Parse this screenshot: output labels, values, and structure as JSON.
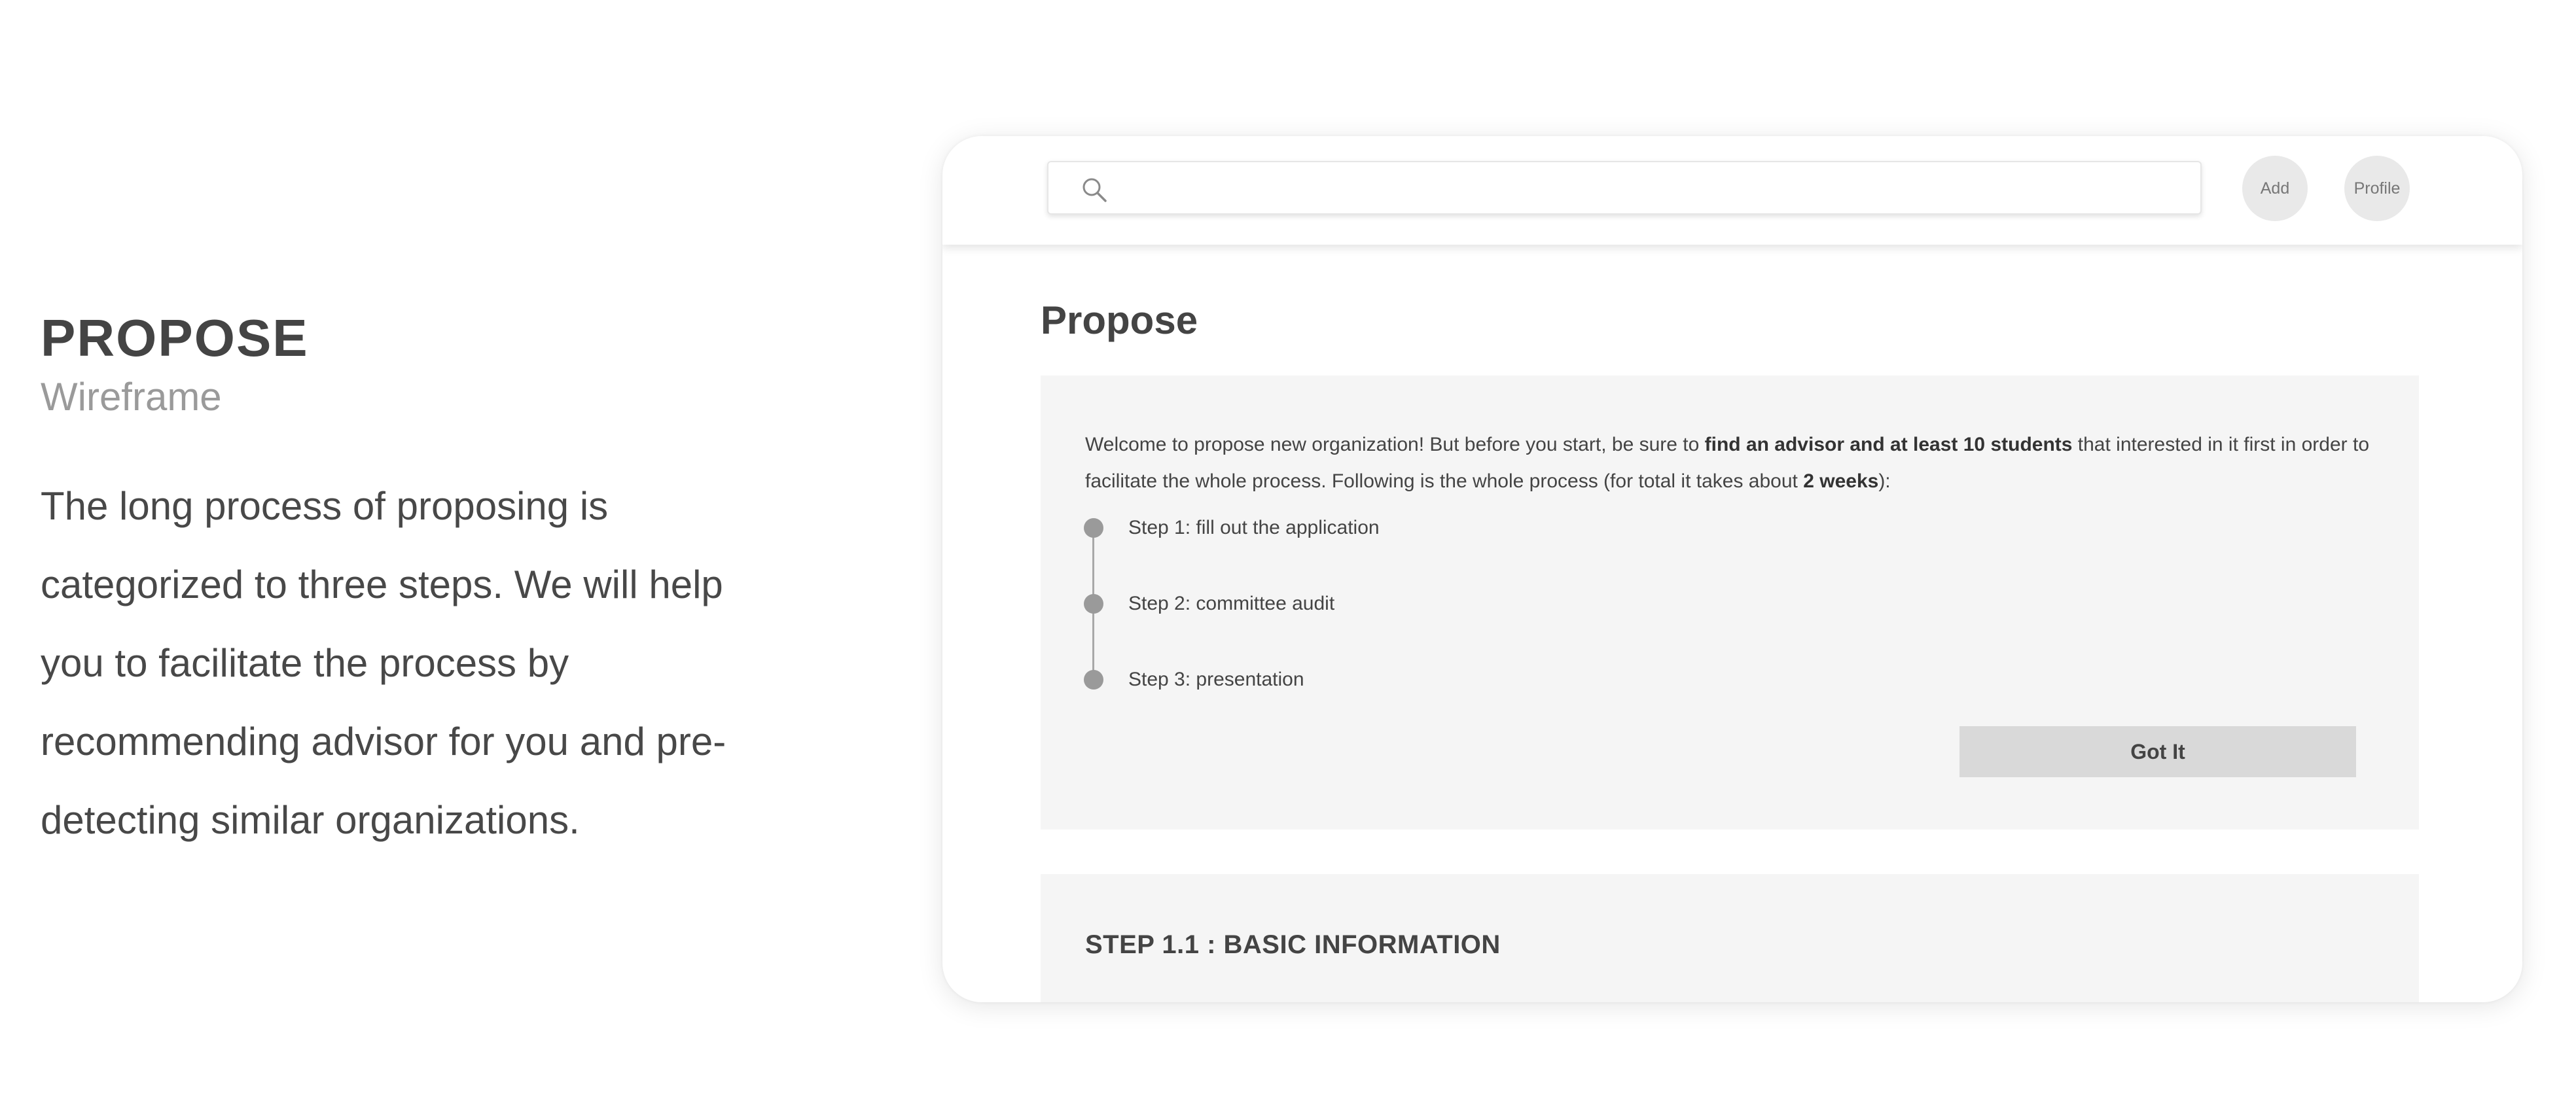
{
  "left": {
    "title": "PROPOSE",
    "subtitle": "Wireframe",
    "description_lines": [
      "The long process of proposing is",
      "categorized to three steps. We will help",
      "you to facilitate the process by",
      "recommending advisor for you and pre-",
      "detecting similar organizations."
    ]
  },
  "topbar": {
    "search_icon": "search-icon",
    "search_value": "",
    "add_label": "Add",
    "profile_label": "Profile"
  },
  "main": {
    "page_title": "Propose",
    "intro": {
      "part1": "Welcome to propose new organization! But before you start, be sure to ",
      "bold1": "find an advisor and at least 10 students",
      "part2": " that interested in it first in order to facilitate the whole process. Following is the whole process (for total it takes about ",
      "bold2": "2 weeks",
      "part3": "):"
    },
    "steps": [
      {
        "label": "Step 1: fill out the application"
      },
      {
        "label": "Step 2: committee audit"
      },
      {
        "label": "Step 3: presentation"
      }
    ],
    "got_it_label": "Got It",
    "step_section_title": "STEP 1.1 : BASIC INFORMATION"
  },
  "colors": {
    "panel_background": "#f5f5f5",
    "button_gray": "#d9d9d9",
    "circle_button": "#e9e9e9",
    "step_dot": "#9a9a9a",
    "text_primary": "#444444",
    "text_muted": "#9a9a9a"
  }
}
